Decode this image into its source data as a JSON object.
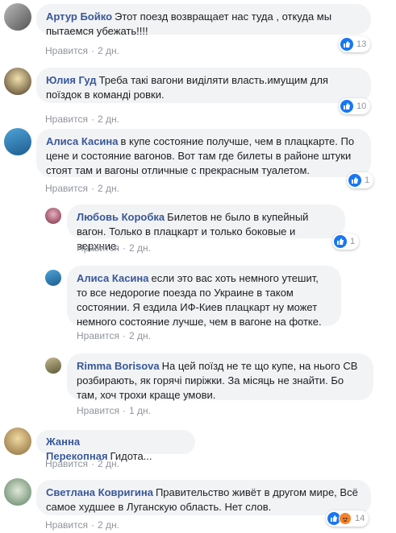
{
  "like_label": "Нравится",
  "comments": [
    {
      "author": "Артур Бойко",
      "text": "Этот поезд возвращает нас туда , откуда мы пытаемся убежать!!!!",
      "time": "2 дн.",
      "reactions": "13"
    },
    {
      "author": "Юлия Гуд",
      "text": "Треба такі вагони виділяти власть.имущим для поїздок в команді ровки.",
      "time": "2 дн.",
      "reactions": "10"
    },
    {
      "author": "Алиса Касина",
      "text": "в купе состояние получше, чем в плацкарте. По цене и состояние вагонов. Вот там где билеты в районе штуки стоят там и вагоны отличные с прекрасным туалетом.",
      "time": "2 дн.",
      "reactions": "1"
    },
    {
      "author": "Любовь Коробка",
      "text": "Билетов не было в купейный вагон. Только в плацкарт и только боковые и верхние.",
      "time": "2 дн.",
      "reactions": "1"
    },
    {
      "author": "Алиса Касина",
      "text": "если это вас хоть немного утешит, то все недорогие поезда по Украине в таком состоянии. Я ездила ИФ-Киев плацкарт ну может немного состояние лучше, чем в вагоне на фотке.",
      "time": "2 дн."
    },
    {
      "author": "Rimma Borisova",
      "text": "На цей поїзд не те що купе, на нього СВ розбирають, як горячі пиріжки. За місяць не знайти. Бо там, хоч трохи краще умови.",
      "time": "1 дн."
    },
    {
      "author": "Жанна Перекопная",
      "text": "Гидота...",
      "time": "2 дн."
    },
    {
      "author": "Светлана Ковригина",
      "text": "Правительство живёт в другом мире, Всё самое худшее в Луганскую область. Нет слов.",
      "time": "2 дн.",
      "reactions": "14"
    }
  ]
}
